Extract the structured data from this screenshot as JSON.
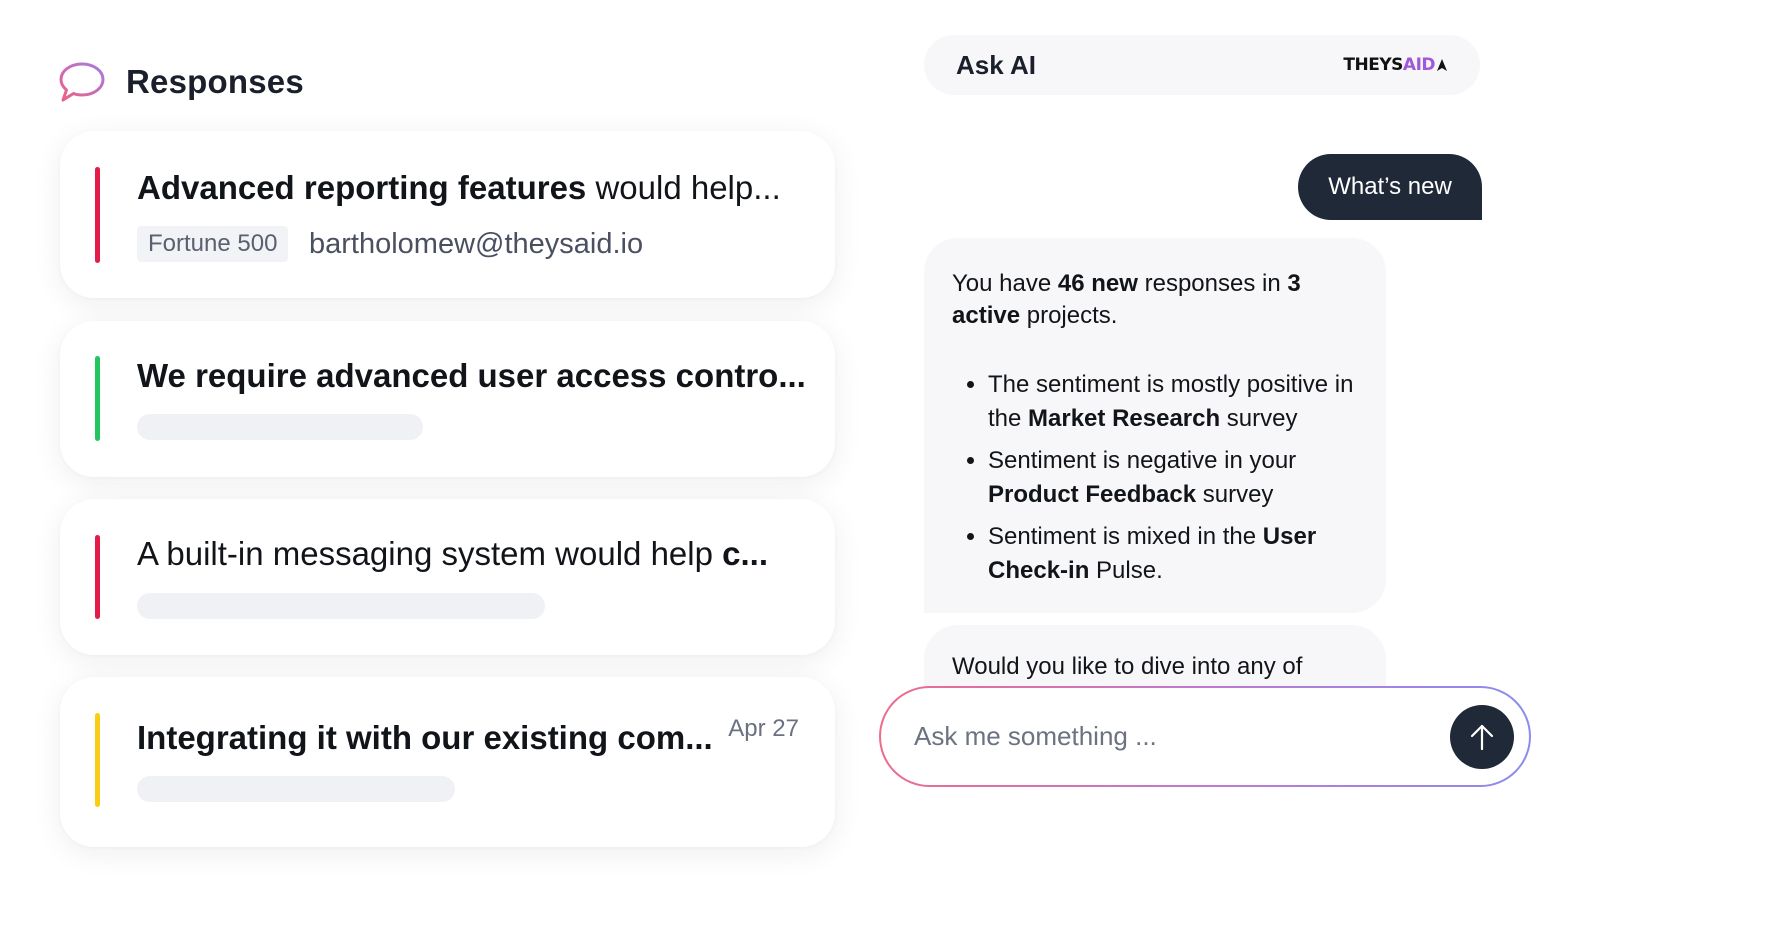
{
  "responses": {
    "title": "Responses",
    "cards": [
      {
        "headline_bold": "Advanced reporting features",
        "headline_rest": " would help...",
        "tag": "Fortune 500",
        "email": "bartholomew@theysaid.io",
        "sentiment_color": "#e11d48"
      },
      {
        "headline_bold": "We require advanced user access contro...",
        "headline_rest": "",
        "sentiment_color": "#22c55e"
      },
      {
        "headline_plain": "A built-in messaging system would help ",
        "headline_bold": "c...",
        "sentiment_color": "#e11d48"
      },
      {
        "headline_bold": "Integrating it with our existing com...",
        "date": "Apr 27",
        "sentiment_color": "#facc15"
      }
    ]
  },
  "ask_ai": {
    "title": "Ask AI",
    "logo_text_a": "THEYS",
    "logo_text_b": "AID",
    "user_message": "What’s new",
    "ai_message": {
      "p1_a": "You have ",
      "p1_b": "46 new",
      "p1_c": " responses in ",
      "p1_d": "3 active",
      "p1_e": " projects.",
      "bullets": [
        {
          "a": "The sentiment is mostly positive in the ",
          "b": "Market Research",
          "c": " survey"
        },
        {
          "a": "Sentiment is negative in your ",
          "b": "Product Feedback",
          "c": " survey"
        },
        {
          "a": "Sentiment is mixed in the ",
          "b": "User Check-in",
          "c": " Pulse."
        }
      ]
    },
    "ai_message_2": "Would you like to dive into any of",
    "input_placeholder": "Ask me something ..."
  }
}
